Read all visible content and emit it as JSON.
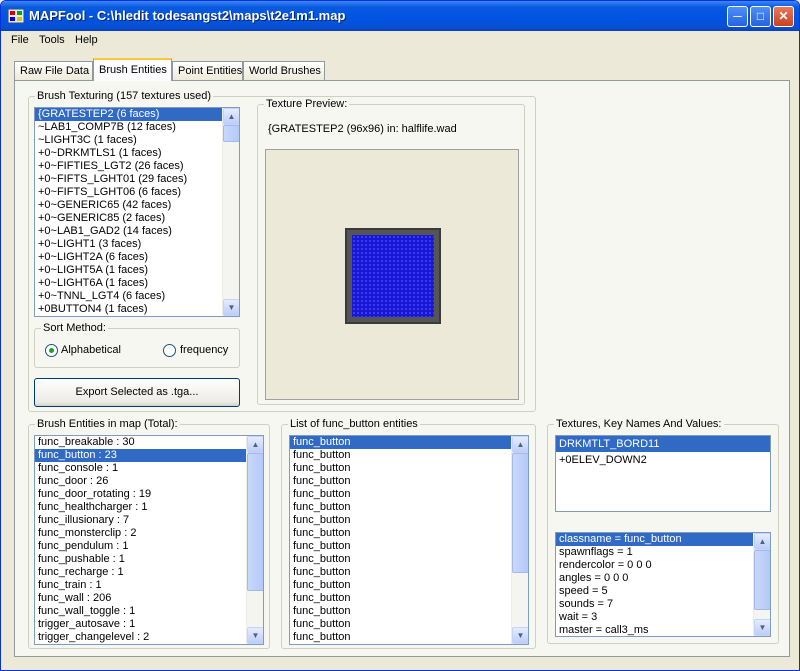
{
  "window": {
    "title": "MAPFool - C:\\hledit todesangst2\\maps\\t2e1m1.map",
    "icon": "map-grid-icon",
    "controls": [
      "minimize-icon",
      "maximize-icon",
      "close-icon"
    ]
  },
  "menu": {
    "file": "File",
    "tools": "Tools",
    "help": "Help"
  },
  "tabs": [
    "Raw File Data",
    "Brush Entities",
    "Point Entities",
    "World Brushes"
  ],
  "active_tab": "Brush Entities",
  "brush_texturing": {
    "label": "Brush Texturing (157 textures used)",
    "items": [
      "{GRATESTEP2 (6 faces)",
      "~LAB1_COMP7B (12 faces)",
      "~LIGHT3C (1 faces)",
      "+0~DRKMTLS1 (1 faces)",
      "+0~FIFTIES_LGT2 (26 faces)",
      "+0~FIFTS_LGHT01 (29 faces)",
      "+0~FIFTS_LGHT06 (6 faces)",
      "+0~GENERIC65 (42 faces)",
      "+0~GENERIC85 (2 faces)",
      "+0~LAB1_GAD2 (14 faces)",
      "+0~LIGHT1 (3 faces)",
      "+0~LIGHT2A (6 faces)",
      "+0~LIGHT5A (1 faces)",
      "+0~LIGHT6A (1 faces)",
      "+0~TNNL_LGT4 (6 faces)",
      "+0BUTTON4 (1 faces)"
    ],
    "selected_index": 0
  },
  "sort_method": {
    "label": "Sort Method:",
    "options": [
      "Alphabetical",
      "frequency"
    ],
    "selected": "Alphabetical"
  },
  "export_button": "Export Selected as .tga...",
  "texture_preview": {
    "label": "Texture Preview:",
    "info": "{GRATESTEP2 (96x96) in: halflife.wad",
    "colors": {
      "grate_fill": "#1a1ad8",
      "border": "#3a3a3a"
    }
  },
  "brush_entities": {
    "label": "Brush Entities in map (Total):",
    "items": [
      "func_breakable : 30",
      "func_button : 23",
      "func_console : 1",
      "func_door : 26",
      "func_door_rotating : 19",
      "func_healthcharger : 1",
      "func_illusionary : 7",
      "func_monsterclip : 2",
      "func_pendulum : 1",
      "func_pushable : 1",
      "func_recharge : 1",
      "func_train : 1",
      "func_wall : 206",
      "func_wall_toggle : 1",
      "trigger_autosave : 1",
      "trigger_changelevel : 2"
    ],
    "selected_index": 1
  },
  "entity_list": {
    "label": "List of func_button entities",
    "items": [
      "func_button",
      "func_button",
      "func_button",
      "func_button",
      "func_button",
      "func_button",
      "func_button",
      "func_button",
      "func_button",
      "func_button",
      "func_button",
      "func_button",
      "func_button",
      "func_button",
      "func_button",
      "func_button"
    ],
    "selected_index": 0
  },
  "textures_kv": {
    "label": "Textures, Key Names And Values:",
    "textures": [
      "DRKMTLT_BORD11",
      "+0ELEV_DOWN2"
    ],
    "selected_texture_index": 0,
    "keyvalues": [
      "classname = func_button",
      "spawnflags = 1",
      "rendercolor = 0 0 0",
      "angles = 0 0 0",
      "speed = 5",
      "sounds = 7",
      "wait = 3",
      "master = call3_ms"
    ],
    "selected_kv_index": 0
  },
  "colors": {
    "titlebar": "#0054e3",
    "selection": "#316ac5",
    "panel": "#f7f7f2",
    "window": "#ece9d8"
  }
}
